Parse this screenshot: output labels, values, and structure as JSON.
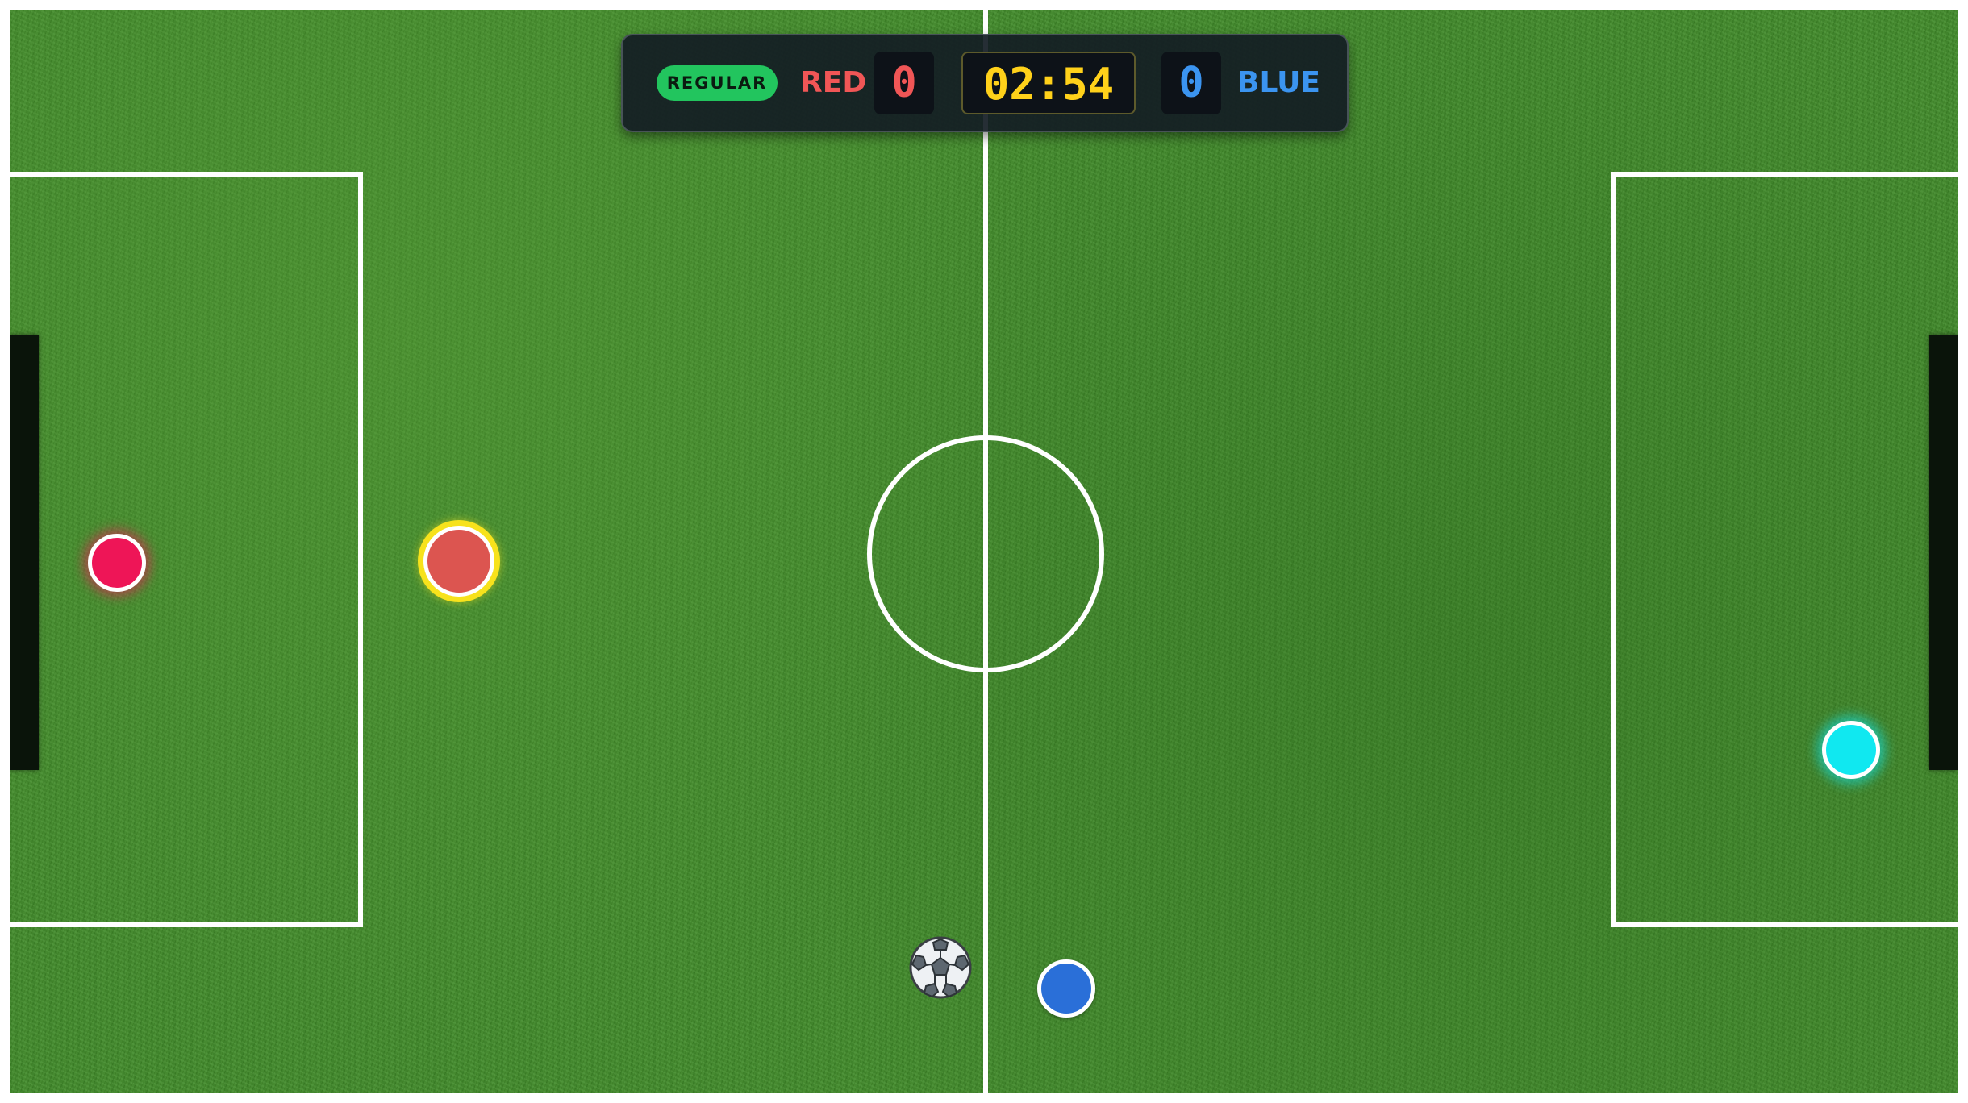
{
  "scoreboard": {
    "mode": "REGULAR",
    "red_team": "RED",
    "red_score": "0",
    "timer": "02:54",
    "blue_score": "0",
    "blue_team": "BLUE"
  },
  "colors": {
    "red_keeper": "#ee1557",
    "red_player_active": "#dc5550",
    "active_highlight": "#f7e21c",
    "blue_keeper": "#10e8f0",
    "blue_player": "#2a6fd8",
    "pitch": "#3f8a28",
    "mode_badge": "#22c55e",
    "timer_text": "#ffd11a"
  },
  "entities": {
    "ball_icon": "soccer-ball-icon"
  }
}
